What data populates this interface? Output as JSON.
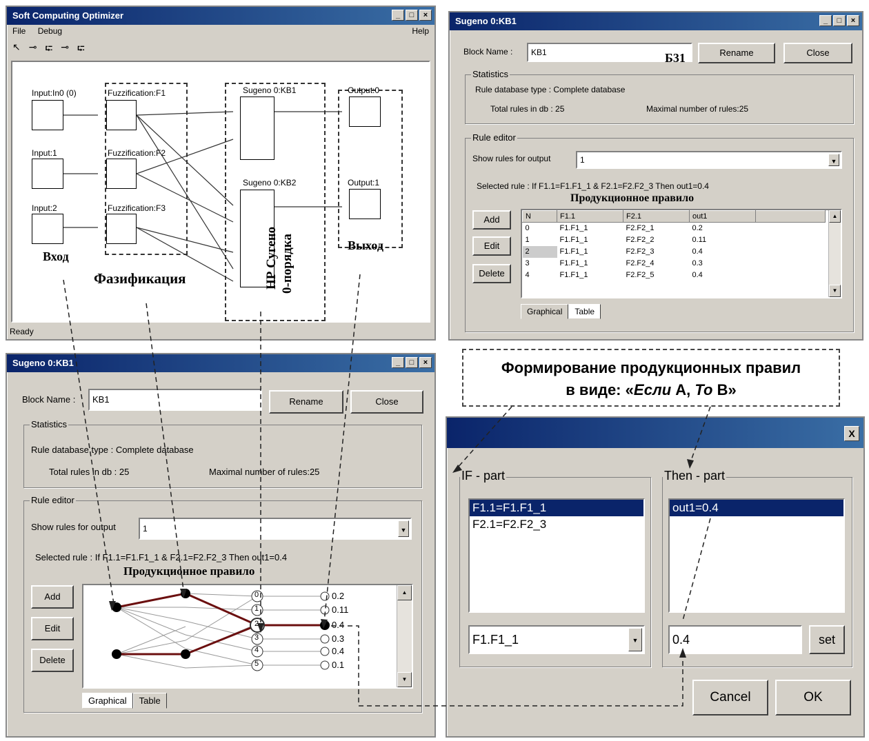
{
  "main_window": {
    "title": "Soft Computing Optimizer",
    "menu": {
      "file": "File",
      "debug": "Debug",
      "help": "Help"
    },
    "status": "Ready",
    "nodes": {
      "input0": "Input:In0 (0)",
      "input1": "Input:1",
      "input2": "Input:2",
      "fuzz1": "Fuzzification:F1",
      "fuzz2": "Fuzzification:F2",
      "fuzz3": "Fuzzification:F3",
      "sug1": "Sugeno 0:KB1",
      "sug2": "Sugeno 0:KB2",
      "out0": "Output:0",
      "out1": "Output:1"
    },
    "captions": {
      "input": "Вход",
      "fuzzification": "Фазификация",
      "sugeno_line1": "НР Сугено",
      "sugeno_line2": "0-порядка",
      "output": "Выход"
    }
  },
  "kb_top": {
    "title": "Sugeno 0:KB1",
    "block_name_label": "Block Name :",
    "block_name_value": "KB1",
    "block_annot": "Б31",
    "rename": "Rename",
    "close": "Close",
    "statistics": "Statistics",
    "db_type": "Rule database type : Complete database",
    "total": "Total rules in db : 25",
    "maximal": "Maximal number of rules:25",
    "rule_editor": "Rule editor",
    "show_rules_label": "Show rules for output",
    "show_rules_value": "1",
    "selected_rule": "Selected rule : If F1.1=F1.F1_1 & F2.1=F2.F2_3 Then out1=0.4",
    "prod_rule": "Продукционное правило",
    "add": "Add",
    "edit": "Edit",
    "delete": "Delete",
    "table_headers": [
      "N",
      "F1.1",
      "F2.1",
      "out1"
    ],
    "rows": [
      [
        "0",
        "F1.F1_1",
        "F2.F2_1",
        "0.2"
      ],
      [
        "1",
        "F1.F1_1",
        "F2.F2_2",
        "0.11"
      ],
      [
        "2",
        "F1.F1_1",
        "F2.F2_3",
        "0.4"
      ],
      [
        "3",
        "F1.F1_1",
        "F2.F2_4",
        "0.3"
      ],
      [
        "4",
        "F1.F1_1",
        "F2.F2_5",
        "0.4"
      ]
    ],
    "tab_graphical": "Graphical",
    "tab_table": "Table"
  },
  "kb_bottom": {
    "title": "Sugeno 0:KB1",
    "block_name_label": "Block Name :",
    "block_name_value": "KB1",
    "rename": "Rename",
    "close": "Close",
    "statistics": "Statistics",
    "db_type": "Rule database type : Complete database",
    "total": "Total rules in db : 25",
    "maximal": "Maximal number of rules:25",
    "rule_editor": "Rule editor",
    "show_rules_label": "Show rules for output",
    "show_rules_value": "1",
    "selected_rule": "Selected rule : If F1.1=F1.F1_1 & F2.1=F2.F2_3 Then out1=0.4",
    "prod_rule": "Продукционное правило",
    "add": "Add",
    "edit": "Edit",
    "delete": "Delete",
    "graph_nums": [
      "0",
      "1",
      "2",
      "3",
      "4",
      "5"
    ],
    "graph_outs": [
      "0.2",
      "0.11",
      "0.4",
      "0.3",
      "0.4",
      "0.1"
    ],
    "tab_graphical": "Graphical",
    "tab_table": "Table"
  },
  "callout": {
    "line1": "Формирование продукционных правил",
    "line2_a": "в виде: «",
    "line2_if": "Если",
    "line2_b": " А, ",
    "line2_then": "То",
    "line2_c": " В»"
  },
  "dialog": {
    "close": "X",
    "if_part": "IF - part",
    "then_part": "Then - part",
    "if_items": [
      "F1.1=F1.F1_1",
      "F2.1=F2.F2_3"
    ],
    "then_items": [
      "out1=0.4"
    ],
    "if_select": "F1.F1_1",
    "then_value": "0.4",
    "set": "set",
    "cancel": "Cancel",
    "ok": "OK"
  }
}
